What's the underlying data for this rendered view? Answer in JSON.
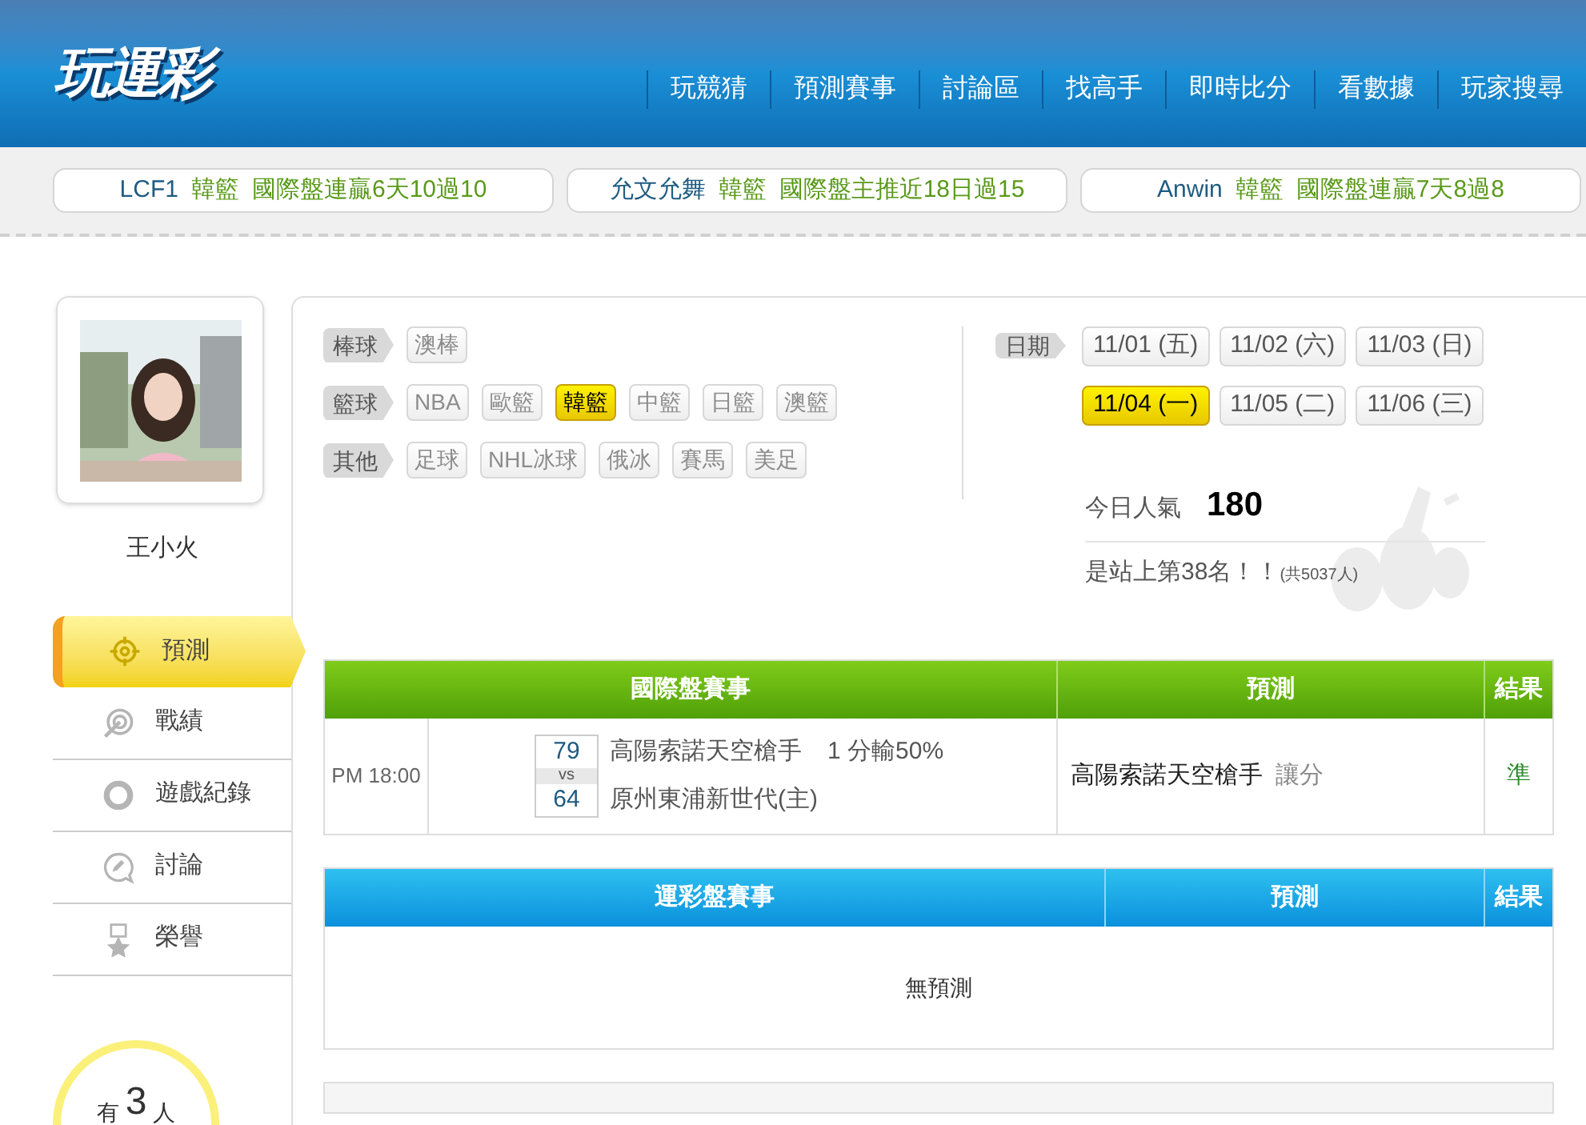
{
  "logo": "玩運彩",
  "nav": [
    "玩競猜",
    "預測賽事",
    "討論區",
    "找高手",
    "即時比分",
    "看數據",
    "玩家搜尋"
  ],
  "ticker": [
    {
      "user": "LCF1",
      "league": "韓籃",
      "text": "國際盤連贏6天10過10"
    },
    {
      "user": "允文允舞",
      "league": "韓籃",
      "text": "國際盤主推近18日過15"
    },
    {
      "user": "Anwin",
      "league": "韓籃",
      "text": "國際盤連贏7天8過8"
    }
  ],
  "profile": {
    "name": "王小火"
  },
  "menu": [
    {
      "label": "預測",
      "kind": "target",
      "selected": true
    },
    {
      "label": "戰績",
      "kind": "dart",
      "selected": false
    },
    {
      "label": "遊戲紀錄",
      "kind": "ring",
      "selected": false
    },
    {
      "label": "討論",
      "kind": "chat",
      "selected": false
    },
    {
      "label": "榮譽",
      "kind": "medal",
      "selected": false
    }
  ],
  "fans": {
    "prefix": "有",
    "count": "3",
    "suffix": "人"
  },
  "sports": [
    {
      "category": "棒球",
      "options": [
        {
          "label": "澳棒",
          "selected": false
        }
      ]
    },
    {
      "category": "籃球",
      "options": [
        {
          "label": "NBA",
          "selected": false
        },
        {
          "label": "歐籃",
          "selected": false
        },
        {
          "label": "韓籃",
          "selected": true
        },
        {
          "label": "中籃",
          "selected": false
        },
        {
          "label": "日籃",
          "selected": false
        },
        {
          "label": "澳籃",
          "selected": false
        }
      ]
    },
    {
      "category": "其他",
      "options": [
        {
          "label": "足球",
          "selected": false
        },
        {
          "label": "NHL冰球",
          "selected": false
        },
        {
          "label": "俄冰",
          "selected": false
        },
        {
          "label": "賽馬",
          "selected": false
        },
        {
          "label": "美足",
          "selected": false
        }
      ]
    }
  ],
  "dates": {
    "label": "日期",
    "items": [
      {
        "label": "11/01 (五)",
        "selected": false
      },
      {
        "label": "11/02 (六)",
        "selected": false
      },
      {
        "label": "11/03 (日)",
        "selected": false
      },
      {
        "label": "11/04 (一)",
        "selected": true
      },
      {
        "label": "11/05 (二)",
        "selected": false
      },
      {
        "label": "11/06 (三)",
        "selected": false
      }
    ]
  },
  "popularity": {
    "label": "今日人氣",
    "value": "180",
    "rank": "是站上第38名！！",
    "total": "(共5037人)"
  },
  "intl_table": {
    "columns": [
      "國際盤賽事",
      "預測",
      "結果"
    ],
    "rows": [
      {
        "time": "PM 18:00",
        "away_score": "79",
        "vs": "vs",
        "home_score": "64",
        "away": "高陽索諾天空槍手",
        "line": "1 分輸50%",
        "home": "原州東浦新世代(主)",
        "pick": "高陽索諾天空槍手",
        "pick_type": "讓分",
        "result": "準"
      }
    ]
  },
  "lottery_table": {
    "columns": [
      "運彩盤賽事",
      "預測",
      "結果"
    ],
    "empty": "無預測"
  }
}
